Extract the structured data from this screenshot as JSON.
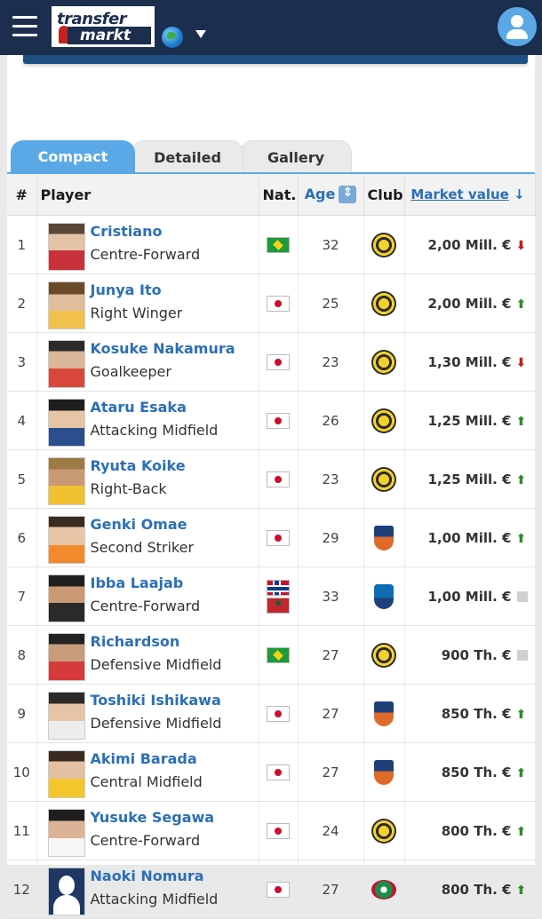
{
  "header": {
    "logo_top": "transfer",
    "logo_bottom": "markt"
  },
  "tabs": [
    "Compact",
    "Detailed",
    "Gallery"
  ],
  "columns": {
    "num": "#",
    "player": "Player",
    "nat": "Nat.",
    "age": "Age",
    "club": "Club",
    "market_value": "Market value",
    "mv_sort_indicator": "↓"
  },
  "players": [
    {
      "num": "1",
      "name": "Cristiano",
      "position": "Centre-Forward",
      "nat": [
        "brazil"
      ],
      "age": "32",
      "club": "kashiwa",
      "value": "2,00 Mill. €",
      "trend": "down"
    },
    {
      "num": "2",
      "name": "Junya Ito",
      "position": "Right Winger",
      "nat": [
        "japan"
      ],
      "age": "25",
      "club": "kashiwa",
      "value": "2,00 Mill. €",
      "trend": "up"
    },
    {
      "num": "3",
      "name": "Kosuke Nakamura",
      "position": "Goalkeeper",
      "nat": [
        "japan"
      ],
      "age": "23",
      "club": "kashiwa",
      "value": "1,30 Mill. €",
      "trend": "down"
    },
    {
      "num": "4",
      "name": "Ataru Esaka",
      "position": "Attacking Midfield",
      "nat": [
        "japan"
      ],
      "age": "26",
      "club": "kashiwa",
      "value": "1,25 Mill. €",
      "trend": "up"
    },
    {
      "num": "5",
      "name": "Ryuta Koike",
      "position": "Right-Back",
      "nat": [
        "japan"
      ],
      "age": "23",
      "club": "kashiwa",
      "value": "1,25 Mill. €",
      "trend": "up"
    },
    {
      "num": "6",
      "name": "Genki Omae",
      "position": "Second Striker",
      "nat": [
        "japan"
      ],
      "age": "29",
      "club": "niigata",
      "value": "1,00 Mill. €",
      "trend": "up"
    },
    {
      "num": "7",
      "name": "Ibba Laajab",
      "position": "Centre-Forward",
      "nat": [
        "norway",
        "morocco"
      ],
      "age": "33",
      "club": "yokohama",
      "value": "1,00 Mill. €",
      "trend": "same"
    },
    {
      "num": "8",
      "name": "Richardson",
      "position": "Defensive Midfield",
      "nat": [
        "brazil"
      ],
      "age": "27",
      "club": "kashiwa",
      "value": "900 Th. €",
      "trend": "same"
    },
    {
      "num": "9",
      "name": "Toshiki Ishikawa",
      "position": "Defensive Midfield",
      "nat": [
        "japan"
      ],
      "age": "27",
      "club": "niigata",
      "value": "850 Th. €",
      "trend": "up"
    },
    {
      "num": "10",
      "name": "Akimi Barada",
      "position": "Central Midfield",
      "nat": [
        "japan"
      ],
      "age": "27",
      "club": "niigata",
      "value": "850 Th. €",
      "trend": "up"
    },
    {
      "num": "11",
      "name": "Yusuke Segawa",
      "position": "Centre-Forward",
      "nat": [
        "japan"
      ],
      "age": "24",
      "club": "kashiwa",
      "value": "800 Th. €",
      "trend": "up"
    },
    {
      "num": "12",
      "name": "Naoki Nomura",
      "position": "Attacking Midfield",
      "nat": [
        "japan"
      ],
      "age": "27",
      "club": "tokushima",
      "value": "800 Th. €",
      "trend": "up"
    }
  ],
  "colors": {
    "header_bg": "#1b2e4e",
    "accent": "#5aa9e6",
    "link": "#2c6fb5",
    "trend_up": "#2e8b2e",
    "trend_down": "#c21f1f"
  }
}
